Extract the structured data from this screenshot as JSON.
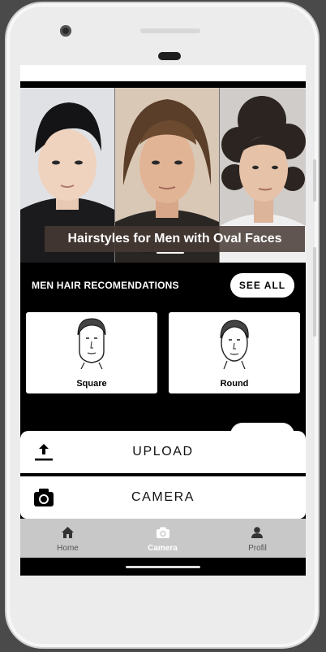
{
  "banner": {
    "caption": "Hairstyles for Men with Oval Faces",
    "faces": [
      "face-portrait-1",
      "face-portrait-2",
      "face-portrait-3"
    ]
  },
  "recommendations": {
    "title": "MEN HAIR RECOMENDATIONS",
    "see_all_label": "SEE ALL",
    "cards": [
      {
        "label": "Square",
        "icon": "square-face-illustration"
      },
      {
        "label": "Round",
        "icon": "round-face-illustration"
      }
    ]
  },
  "sheet": {
    "upload_label": "UPLOAD",
    "upload_icon": "upload-icon",
    "camera_label": "CAMERA",
    "camera_icon": "camera-icon"
  },
  "nav": {
    "items": [
      {
        "label": "Home",
        "icon": "home-icon",
        "active": false
      },
      {
        "label": "Camera",
        "icon": "camera-icon",
        "active": true
      },
      {
        "label": "Profil",
        "icon": "person-icon",
        "active": false
      }
    ]
  },
  "colors": {
    "screen_bg": "#000000",
    "nav_bg": "#c8c8c8",
    "caption_bg": "#463a34"
  }
}
